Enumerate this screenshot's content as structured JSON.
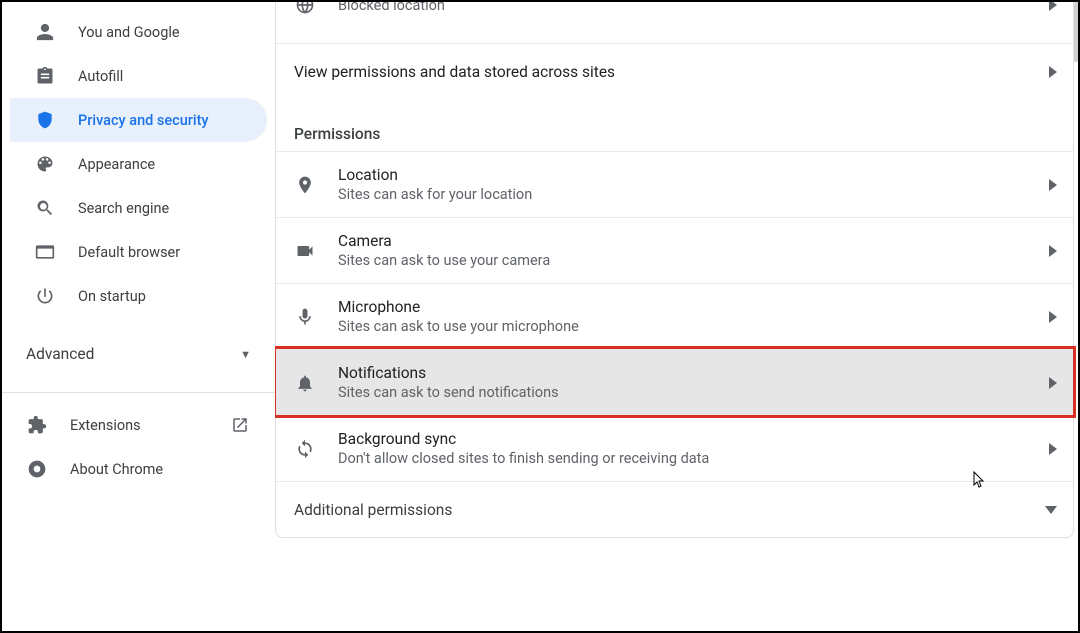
{
  "sidebar": {
    "items": [
      {
        "label": "You and Google"
      },
      {
        "label": "Autofill"
      },
      {
        "label": "Privacy and security"
      },
      {
        "label": "Appearance"
      },
      {
        "label": "Search engine"
      },
      {
        "label": "Default browser"
      },
      {
        "label": "On startup"
      }
    ],
    "advanced_label": "Advanced",
    "extensions_label": "Extensions",
    "about_label": "About Chrome"
  },
  "content": {
    "blocked_row_subtitle": "Blocked location",
    "view_permissions_label": "View permissions and data stored across sites",
    "permissions_heading": "Permissions",
    "permissions": [
      {
        "title": "Location",
        "subtitle": "Sites can ask for your location"
      },
      {
        "title": "Camera",
        "subtitle": "Sites can ask to use your camera"
      },
      {
        "title": "Microphone",
        "subtitle": "Sites can ask to use your microphone"
      },
      {
        "title": "Notifications",
        "subtitle": "Sites can ask to send notifications"
      },
      {
        "title": "Background sync",
        "subtitle": "Don't allow closed sites to finish sending or receiving data"
      }
    ],
    "additional_permissions_label": "Additional permissions"
  }
}
